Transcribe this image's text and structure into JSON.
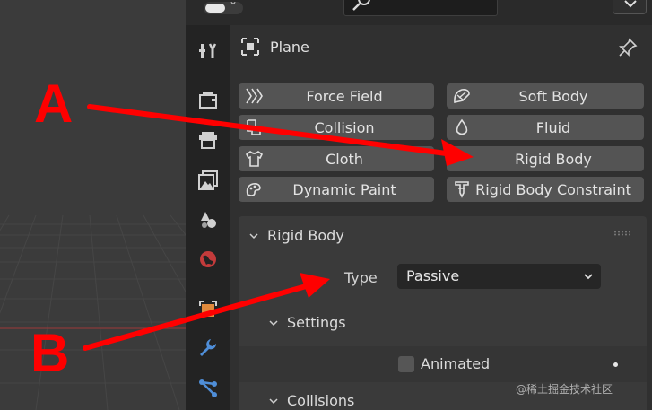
{
  "object": {
    "name": "Plane"
  },
  "physics_buttons": [
    {
      "label": "Force Field",
      "icon": "force-field-icon"
    },
    {
      "label": "Soft Body",
      "icon": "soft-body-icon"
    },
    {
      "label": "Collision",
      "icon": "collision-icon"
    },
    {
      "label": "Fluid",
      "icon": "fluid-icon"
    },
    {
      "label": "Cloth",
      "icon": "cloth-icon"
    },
    {
      "label": "Rigid Body",
      "icon": "rigid-body-icon"
    },
    {
      "label": "Dynamic Paint",
      "icon": "dynamic-paint-icon"
    },
    {
      "label": "Rigid Body Constraint",
      "icon": "rigid-body-constraint-icon"
    }
  ],
  "rigid_body": {
    "title": "Rigid Body",
    "type_label": "Type",
    "type_value": "Passive",
    "settings_title": "Settings",
    "animated_label": "Animated",
    "collisions_title": "Collisions"
  },
  "annotations": {
    "a": "A",
    "b": "B"
  },
  "watermark": "@稀土掘金技术社区",
  "colors": {
    "arrow": "#ff0000",
    "button": "#545454",
    "panel": "#303030",
    "tab_active": "#2f6fb5"
  }
}
